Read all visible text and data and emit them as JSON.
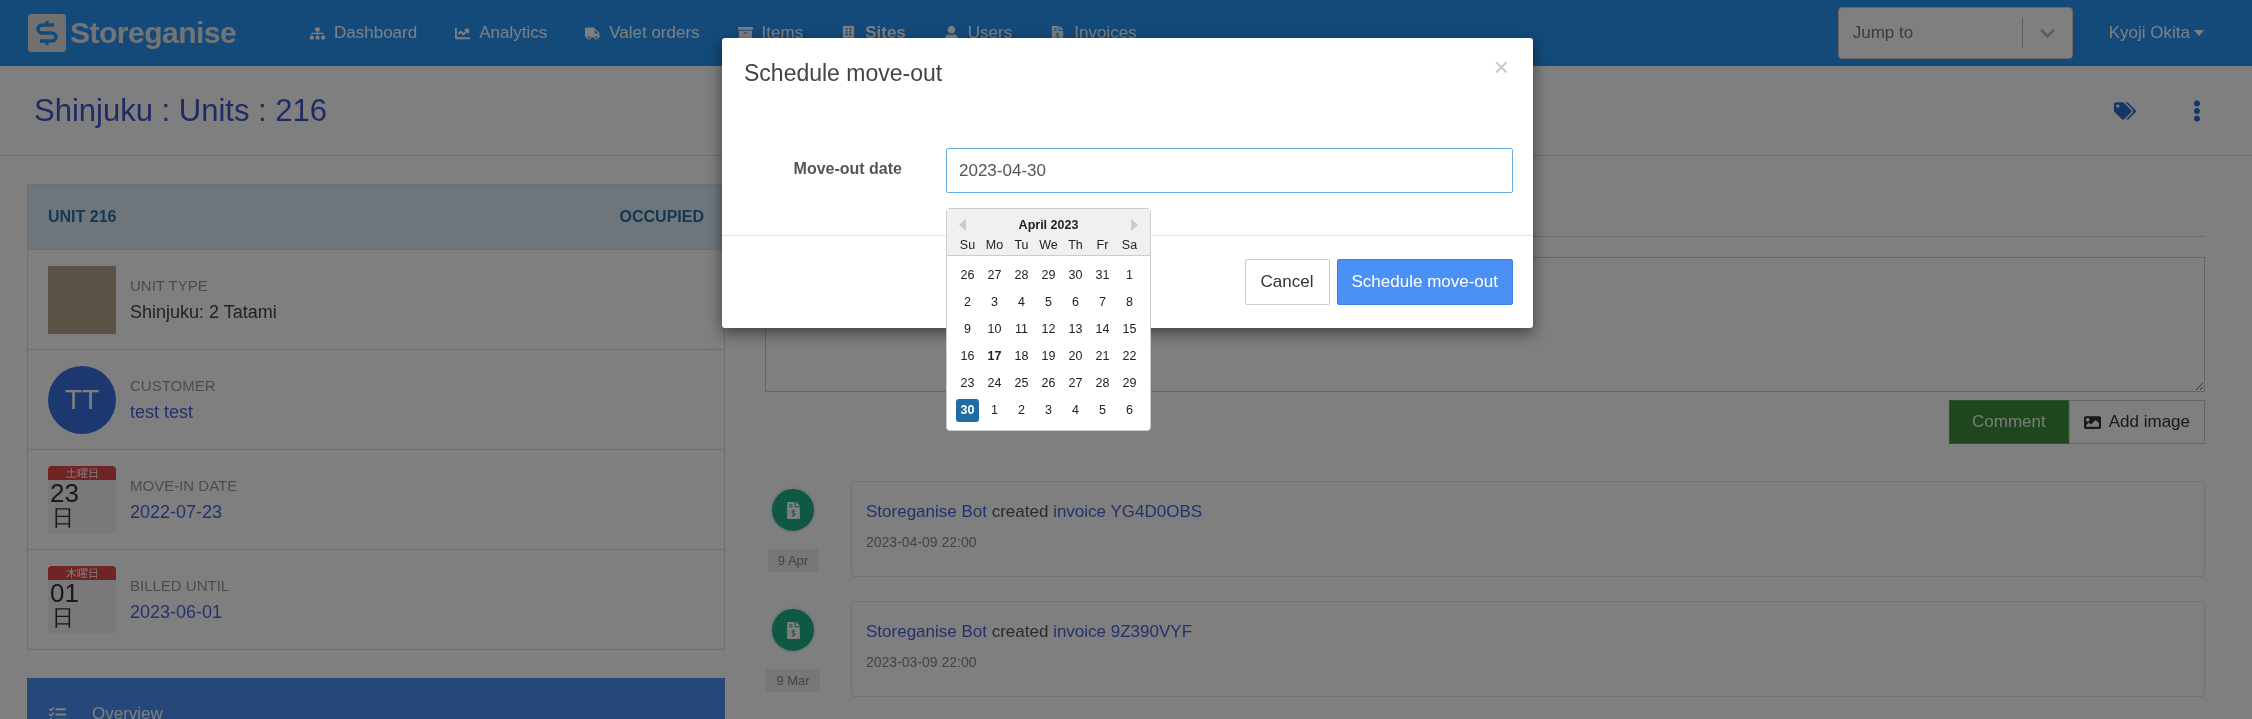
{
  "navbar": {
    "brand": "Storeganise",
    "nav_items": [
      {
        "label": "Dashboard",
        "selected": false
      },
      {
        "label": "Analytics",
        "selected": false
      },
      {
        "label": "Valet orders",
        "selected": false
      },
      {
        "label": "Items",
        "selected": false
      },
      {
        "label": "Sites",
        "selected": true
      },
      {
        "label": "Users",
        "selected": false
      },
      {
        "label": "Invoices",
        "selected": false
      }
    ],
    "jump_to": {
      "placeholder": "Jump to"
    },
    "user": "Kyoji Okita"
  },
  "page_title": "Shinjuku : Units : 216",
  "unit_panel": {
    "title": "UNIT 216",
    "status": "OCCUPIED",
    "rows": [
      {
        "kind": "image",
        "label": "UNIT TYPE",
        "value": "Shinjuku: 2 Tatami"
      },
      {
        "kind": "avatar",
        "initials": "TT",
        "label": "CUSTOMER",
        "value": "test test"
      },
      {
        "kind": "calendar",
        "weekday": "土曜日",
        "day": "23",
        "day_suffix": "日",
        "label": "MOVE-IN DATE",
        "value": "2022-07-23"
      },
      {
        "kind": "calendar",
        "weekday": "木曜日",
        "day": "01",
        "day_suffix": "日",
        "label": "BILLED UNTIL",
        "value": "2023-06-01"
      }
    ]
  },
  "side_menu": [
    {
      "label": "Overview",
      "selected": true
    }
  ],
  "comment_box": {
    "comment_button": "Comment",
    "comment_disabled": true,
    "add_image_button": "Add image"
  },
  "timeline": [
    {
      "actor": "Storeganise Bot",
      "verb": "created",
      "target": "invoice YG4D0OBS",
      "time": "2023-04-09 22:00",
      "date_label": "9 Apr"
    },
    {
      "actor": "Storeganise Bot",
      "verb": "created",
      "target": "invoice 9Z390VYF",
      "time": "2023-03-09 22:00",
      "date_label": "9 Mar"
    }
  ],
  "modal": {
    "title": "Schedule move-out",
    "close": "×",
    "field_label": "Move-out date",
    "field_value": "2023-04-30",
    "cancel": "Cancel",
    "submit": "Schedule move-out"
  },
  "datepicker": {
    "month": "April 2023",
    "weekdays": [
      "Su",
      "Mo",
      "Tu",
      "We",
      "Th",
      "Fr",
      "Sa"
    ],
    "weeks": [
      [
        {
          "day": "26",
          "today": false,
          "selected": false
        },
        {
          "day": "27",
          "today": false,
          "selected": false
        },
        {
          "day": "28",
          "today": false,
          "selected": false
        },
        {
          "day": "29",
          "today": false,
          "selected": false
        },
        {
          "day": "30",
          "today": false,
          "selected": false
        },
        {
          "day": "31",
          "today": false,
          "selected": false
        },
        {
          "day": "1",
          "today": false,
          "selected": false
        }
      ],
      [
        {
          "day": "2",
          "today": false,
          "selected": false
        },
        {
          "day": "3",
          "today": false,
          "selected": false
        },
        {
          "day": "4",
          "today": false,
          "selected": false
        },
        {
          "day": "5",
          "today": false,
          "selected": false
        },
        {
          "day": "6",
          "today": false,
          "selected": false
        },
        {
          "day": "7",
          "today": false,
          "selected": false
        },
        {
          "day": "8",
          "today": false,
          "selected": false
        }
      ],
      [
        {
          "day": "9",
          "today": false,
          "selected": false
        },
        {
          "day": "10",
          "today": false,
          "selected": false
        },
        {
          "day": "11",
          "today": false,
          "selected": false
        },
        {
          "day": "12",
          "today": false,
          "selected": false
        },
        {
          "day": "13",
          "today": false,
          "selected": false
        },
        {
          "day": "14",
          "today": false,
          "selected": false
        },
        {
          "day": "15",
          "today": false,
          "selected": false
        }
      ],
      [
        {
          "day": "16",
          "today": false,
          "selected": false
        },
        {
          "day": "17",
          "today": true,
          "selected": false
        },
        {
          "day": "18",
          "today": false,
          "selected": false
        },
        {
          "day": "19",
          "today": false,
          "selected": false
        },
        {
          "day": "20",
          "today": false,
          "selected": false
        },
        {
          "day": "21",
          "today": false,
          "selected": false
        },
        {
          "day": "22",
          "today": false,
          "selected": false
        }
      ],
      [
        {
          "day": "23",
          "today": false,
          "selected": false
        },
        {
          "day": "24",
          "today": false,
          "selected": false
        },
        {
          "day": "25",
          "today": false,
          "selected": false
        },
        {
          "day": "26",
          "today": false,
          "selected": false
        },
        {
          "day": "27",
          "today": false,
          "selected": false
        },
        {
          "day": "28",
          "today": false,
          "selected": false
        },
        {
          "day": "29",
          "today": false,
          "selected": false
        }
      ],
      [
        {
          "day": "30",
          "today": false,
          "selected": true
        },
        {
          "day": "1",
          "today": false,
          "selected": false
        },
        {
          "day": "2",
          "today": false,
          "selected": false
        },
        {
          "day": "3",
          "today": false,
          "selected": false
        },
        {
          "day": "4",
          "today": false,
          "selected": false
        },
        {
          "day": "5",
          "today": false,
          "selected": false
        },
        {
          "day": "6",
          "today": false,
          "selected": false
        }
      ]
    ]
  }
}
